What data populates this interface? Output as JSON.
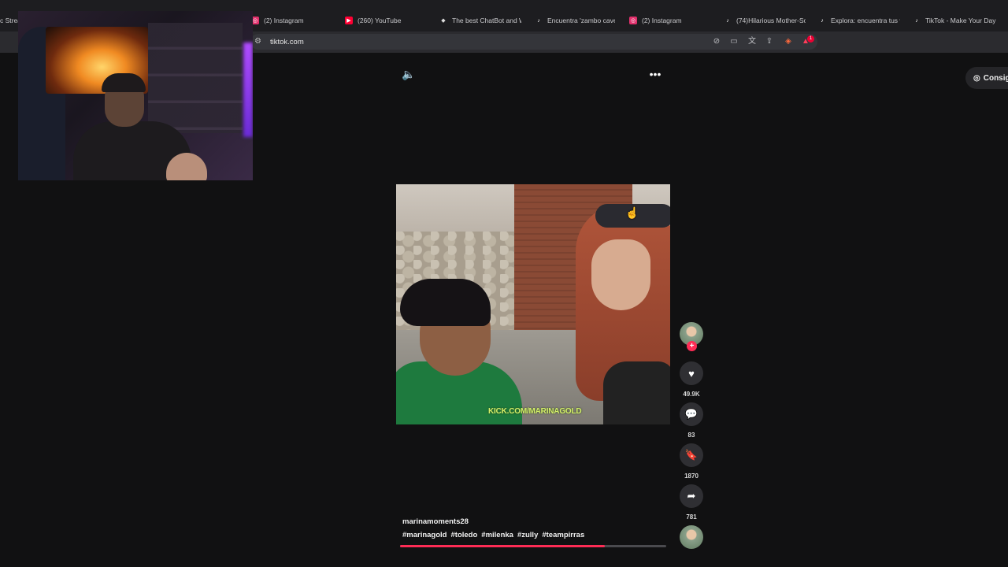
{
  "browser": {
    "tabs": [
      {
        "label": "c Strea",
        "icon": "tab-favicon",
        "color": "#888888"
      },
      {
        "label": "(2) Instagram",
        "icon": "instagram-icon",
        "color": "#e1306c"
      },
      {
        "label": "(260) YouTube",
        "icon": "youtube-icon",
        "color": "#ff0033"
      },
      {
        "label": "The best ChatBot and W",
        "icon": "chatbot-icon",
        "color": "#dddddd"
      },
      {
        "label": "Encuentra 'zambo caver",
        "icon": "tiktok-icon",
        "color": "#ffffff"
      },
      {
        "label": "(2) Instagram",
        "icon": "instagram-icon",
        "color": "#e1306c"
      },
      {
        "label": "(74)Hilarious Mother-So",
        "icon": "tiktok-icon",
        "color": "#ffffff"
      },
      {
        "label": "Explora: encuentra tus v",
        "icon": "tiktok-icon",
        "color": "#ffffff"
      },
      {
        "label": "TikTok - Make Your Day",
        "icon": "tiktok-icon",
        "color": "#ffffff"
      }
    ],
    "url": "tiktok.com",
    "extension_badge": "1"
  },
  "player": {
    "watermark": "KICK.COM/MARINAGOLD",
    "progress": 0.77
  },
  "actions": {
    "likes": "49.9K",
    "comments": "83",
    "saves": "1870",
    "shares": "781",
    "follow_symbol": "+"
  },
  "post": {
    "username": "marinamoments28",
    "hashtags": [
      "#marinagold",
      "#toledo",
      "#milenka",
      "#zully",
      "#teampirras"
    ]
  },
  "right_panel": {
    "button_label": "Consig"
  },
  "colors": {
    "accent": "#fe2c55",
    "background": "#111112"
  }
}
